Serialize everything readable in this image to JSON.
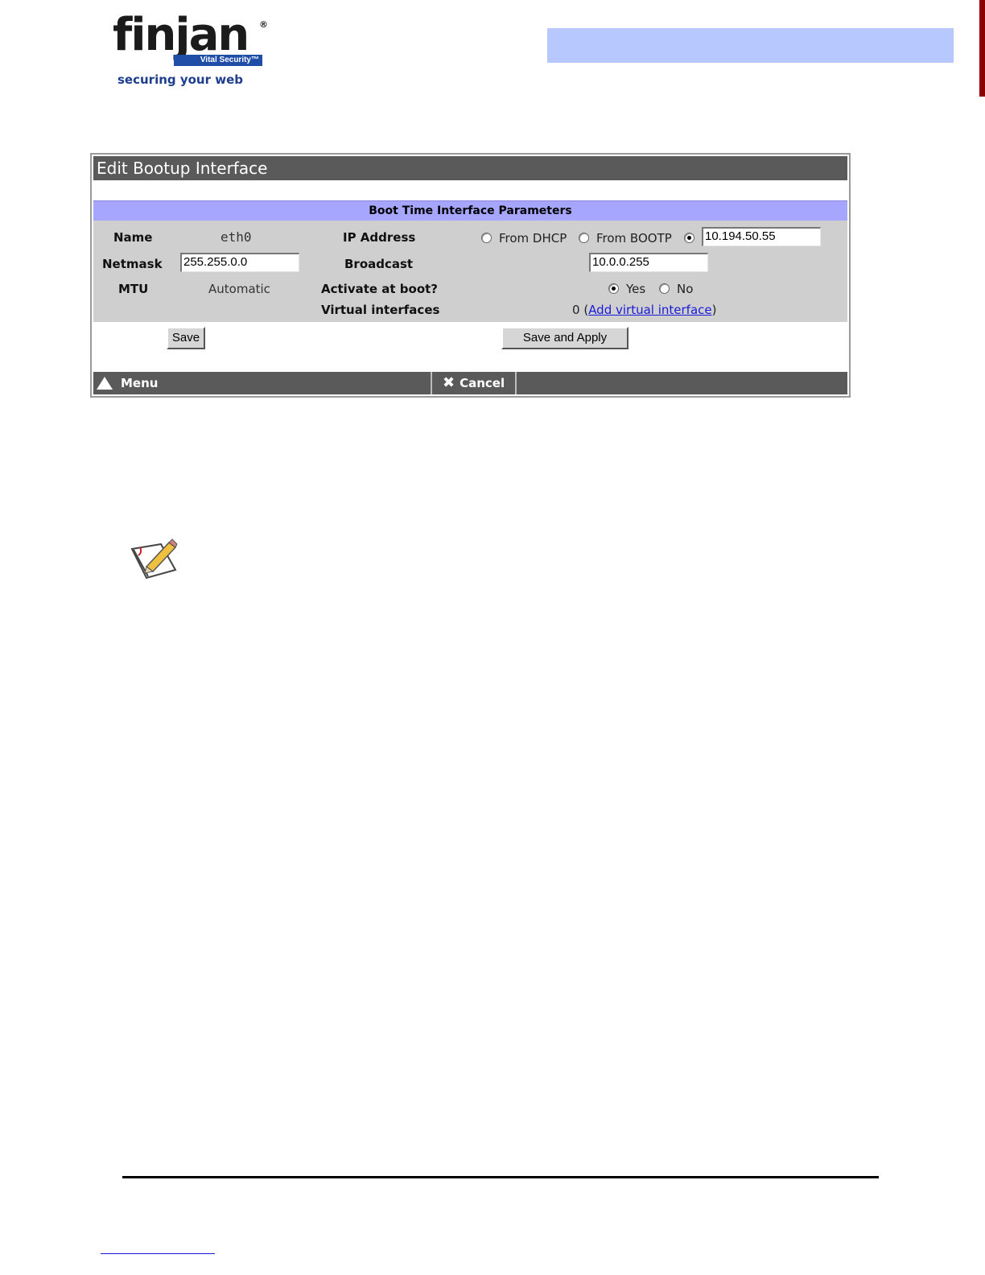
{
  "brand": {
    "name": "finjan",
    "product": "Vital Security™",
    "registered_mark": "®",
    "tagline": "securing your web"
  },
  "window": {
    "title": "Edit Bootup Interface",
    "section_title": "Boot Time Interface Parameters",
    "labels": {
      "name": "Name",
      "netmask": "Netmask",
      "mtu": "MTU",
      "ip_address": "IP Address",
      "broadcast": "Broadcast",
      "activate": "Activate at boot?",
      "virtual": "Virtual interfaces"
    },
    "values": {
      "name": "eth0",
      "netmask": "255.255.0.0",
      "mtu": "Automatic",
      "ip": "10.194.50.55",
      "broadcast": "10.0.0.255",
      "virtual_count": "0",
      "virtual_open": "(",
      "virtual_link": "Add virtual interface",
      "virtual_close": ")"
    },
    "ip_options": {
      "dhcp": "From DHCP",
      "bootp": "From BOOTP",
      "selected": "static"
    },
    "activate_options": {
      "yes": "Yes",
      "no": "No",
      "selected": "yes"
    },
    "buttons": {
      "save": "Save",
      "save_apply": "Save and Apply"
    },
    "footer": {
      "menu": "Menu",
      "cancel": "Cancel"
    }
  },
  "colors": {
    "header_band": "#b6c8ff",
    "section_bar": "#a6a6ff",
    "titlebar": "#5a5a5a",
    "brand_blue": "#1f4ea8"
  },
  "icons": [
    "up-triangle-icon",
    "x-cancel-icon",
    "note-pencil-icon"
  ]
}
